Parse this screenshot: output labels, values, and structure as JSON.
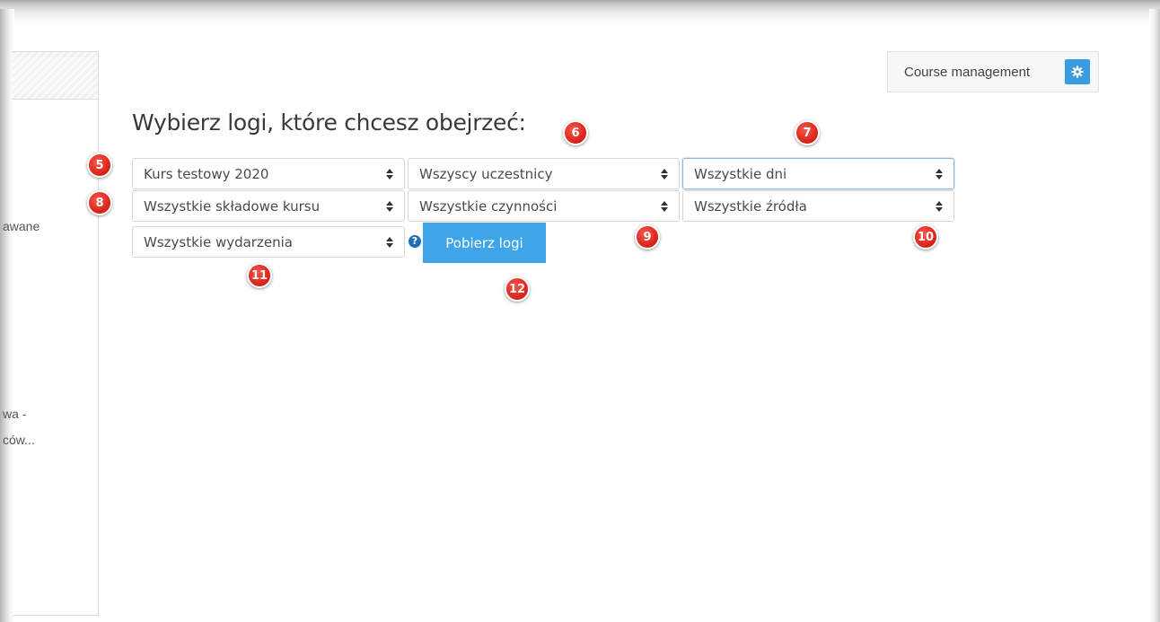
{
  "left_panel": {
    "fragments": [
      "awane",
      "wa -",
      "ców..."
    ]
  },
  "header": {
    "course_management_label": "Course management",
    "course_management_icon": "gear-icon"
  },
  "page_title": "Wybierz logi, które chcesz obejrzeć:",
  "filters": {
    "course": "Kurs testowy 2020",
    "participants": "Wszyscy uczestnicy",
    "days": "Wszystkie dni",
    "activities": "Wszystkie składowe kursu",
    "actions": "Wszystkie czynności",
    "sources": "Wszystkie źródła",
    "events": "Wszystkie wydarzenia"
  },
  "help_icon": "?",
  "submit_label": "Pobierz logi",
  "badges": {
    "b5": "5",
    "b6": "6",
    "b7": "7",
    "b8": "8",
    "b9": "9",
    "b10": "10",
    "b11": "11",
    "b12": "12"
  },
  "colors": {
    "accent": "#3fa5e8",
    "badge": "#e02b20"
  }
}
